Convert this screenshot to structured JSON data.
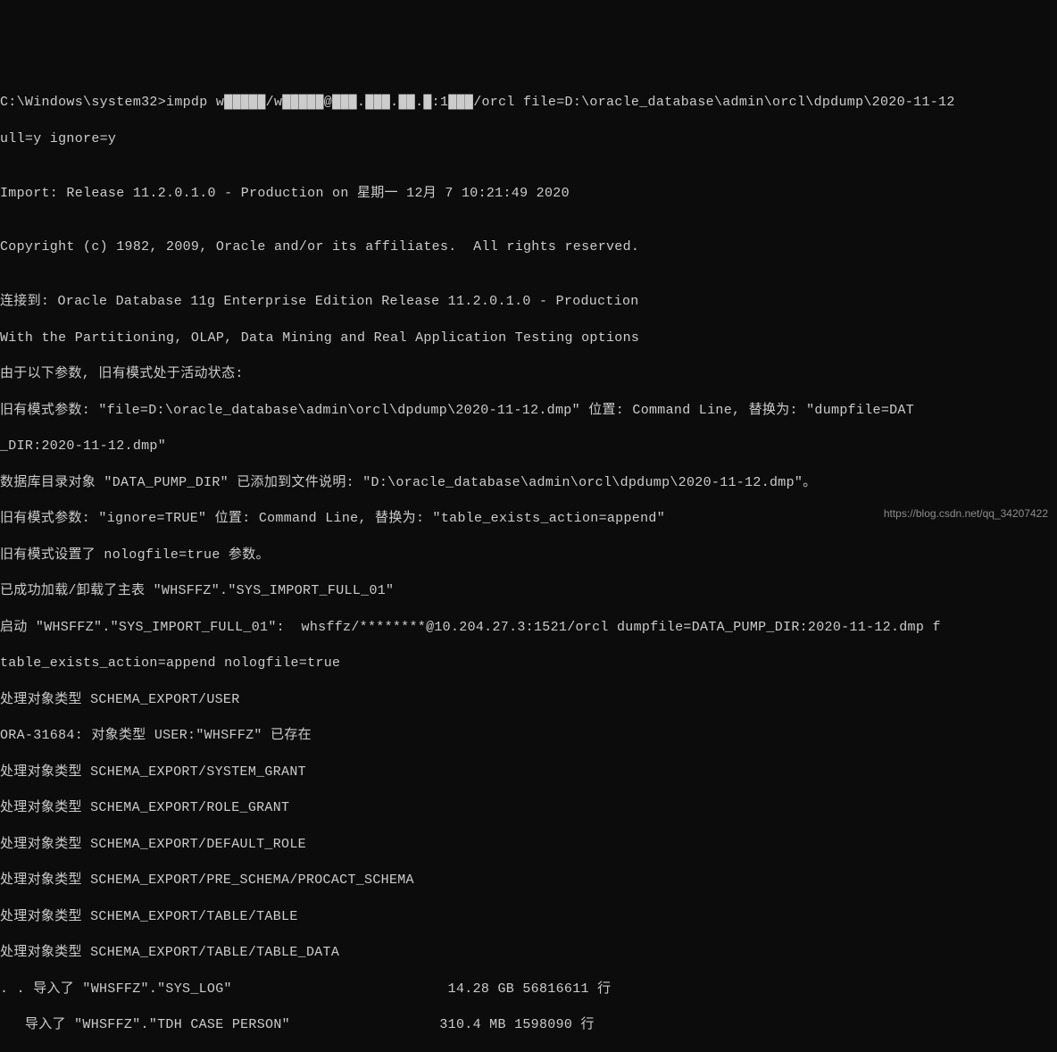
{
  "prompt": {
    "path": "C:\\Windows\\system32>",
    "command_prefix": "impdp ",
    "redacted_1": "w█████/w█████@███.███.██.█:1███",
    "command_suffix": "/orcl file=D:\\oracle_database\\admin\\orcl\\dpdump\\2020-11-12",
    "line2": "ull=y ignore=y"
  },
  "output": {
    "blank1": "",
    "import_line": "Import: Release 11.2.0.1.0 - Production on 星期一 12月 7 10:21:49 2020",
    "blank2": "",
    "copyright": "Copyright (c) 1982, 2009, Oracle and/or its affiliates.  All rights reserved.",
    "blank3": "",
    "connected": "连接到: Oracle Database 11g Enterprise Edition Release 11.2.0.1.0 - Production",
    "with_opts": "With the Partitioning, OLAP, Data Mining and Real Application Testing options",
    "legacy_active": "由于以下参数, 旧有模式处于活动状态:",
    "legacy_param_file": "旧有模式参数: \"file=D:\\oracle_database\\admin\\orcl\\dpdump\\2020-11-12.dmp\" 位置: Command Line, 替换为: \"dumpfile=DAT",
    "dir_cont": "_DIR:2020-11-12.dmp\"",
    "data_pump_dir": "数据库目录对象 \"DATA_PUMP_DIR\" 已添加到文件说明: \"D:\\oracle_database\\admin\\orcl\\dpdump\\2020-11-12.dmp\"。",
    "legacy_ignore": "旧有模式参数: \"ignore=TRUE\" 位置: Command Line, 替换为: \"table_exists_action=append\"",
    "legacy_nolog": "旧有模式设置了 nologfile=true 参数。",
    "master_table": "已成功加载/卸载了主表 \"WHSFFZ\".\"SYS_IMPORT_FULL_01\"",
    "starting": "启动 \"WHSFFZ\".\"SYS_IMPORT_FULL_01\":  whsffz/********@10.204.27.3:1521/orcl dumpfile=DATA_PUMP_DIR:2020-11-12.dmp f",
    "table_exists": "table_exists_action=append nologfile=true",
    "proc_user": "处理对象类型 SCHEMA_EXPORT/USER",
    "ora_error": "ORA-31684: 对象类型 USER:\"WHSFFZ\" 已存在",
    "proc_sysgrant": "处理对象类型 SCHEMA_EXPORT/SYSTEM_GRANT",
    "proc_rolegrant": "处理对象类型 SCHEMA_EXPORT/ROLE_GRANT",
    "proc_defrole": "处理对象类型 SCHEMA_EXPORT/DEFAULT_ROLE",
    "proc_procact": "处理对象类型 SCHEMA_EXPORT/PRE_SCHEMA/PROCACT_SCHEMA",
    "proc_table": "处理对象类型 SCHEMA_EXPORT/TABLE/TABLE",
    "proc_tabledata": "处理对象类型 SCHEMA_EXPORT/TABLE/TABLE_DATA",
    "import_syslog": ". . 导入了 \"WHSFFZ\".\"SYS_LOG\"                          14.28 GB 56816611 行",
    "import_tdh": "   导入了 \"WHSFFZ\".\"TDH CASE PERSON\"                  310.4 MB 1598090 行"
  },
  "watermark": "https://blog.csdn.net/qq_34207422"
}
